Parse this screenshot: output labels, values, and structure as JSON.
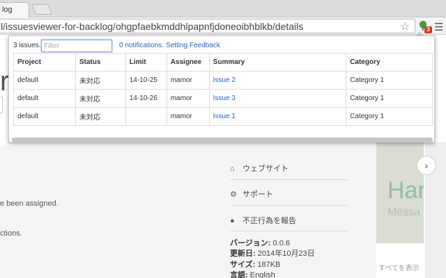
{
  "browser": {
    "tab_title": "log",
    "tab_close": "×",
    "url": "l/issuesviewer-for-backlog/ohgpfaebkmddhlpapnfjdoneoibhblkb/details",
    "extension_badge": "3"
  },
  "background": {
    "big_letter": "r",
    "text_assigned": "e been assigned.",
    "text_actions": "ctions.",
    "links": [
      {
        "label": "ウェブサイト",
        "icon": "home-icon"
      },
      {
        "label": "サポート",
        "icon": "gear-icon"
      },
      {
        "label": "不正行為を報告",
        "icon": "warning-icon"
      }
    ],
    "meta": [
      {
        "label": "バージョン:",
        "value": "0.0.6"
      },
      {
        "label": "更新日:",
        "value": "2014年10月23日"
      },
      {
        "label": "サイズ:",
        "value": "187KB"
      },
      {
        "label": "言語:",
        "value": "English"
      }
    ],
    "promo_big": "Har",
    "promo_small": "Messa",
    "show_all": "すべてを表示"
  },
  "popup": {
    "issue_count": "3 issues.",
    "filter_placeholder": "Filter",
    "notifications_link": "0 notifications.",
    "setting_link": "Setting",
    "feedback_link": "Feedback",
    "columns": [
      "Project",
      "Status",
      "Limit",
      "Assignee",
      "Summary",
      "Category"
    ],
    "rows": [
      {
        "project": "default",
        "status": "未対応",
        "limit": "14-10-25",
        "assignee": "mamor",
        "summary": "Issue 2",
        "category": "Category 1"
      },
      {
        "project": "default",
        "status": "未対応",
        "limit": "14-10-26",
        "assignee": "mamor",
        "summary": "Issue 3",
        "category": "Category 1"
      },
      {
        "project": "default",
        "status": "未対応",
        "limit": "",
        "assignee": "mamor",
        "summary": "Issue 1",
        "category": "Category 1"
      }
    ]
  }
}
